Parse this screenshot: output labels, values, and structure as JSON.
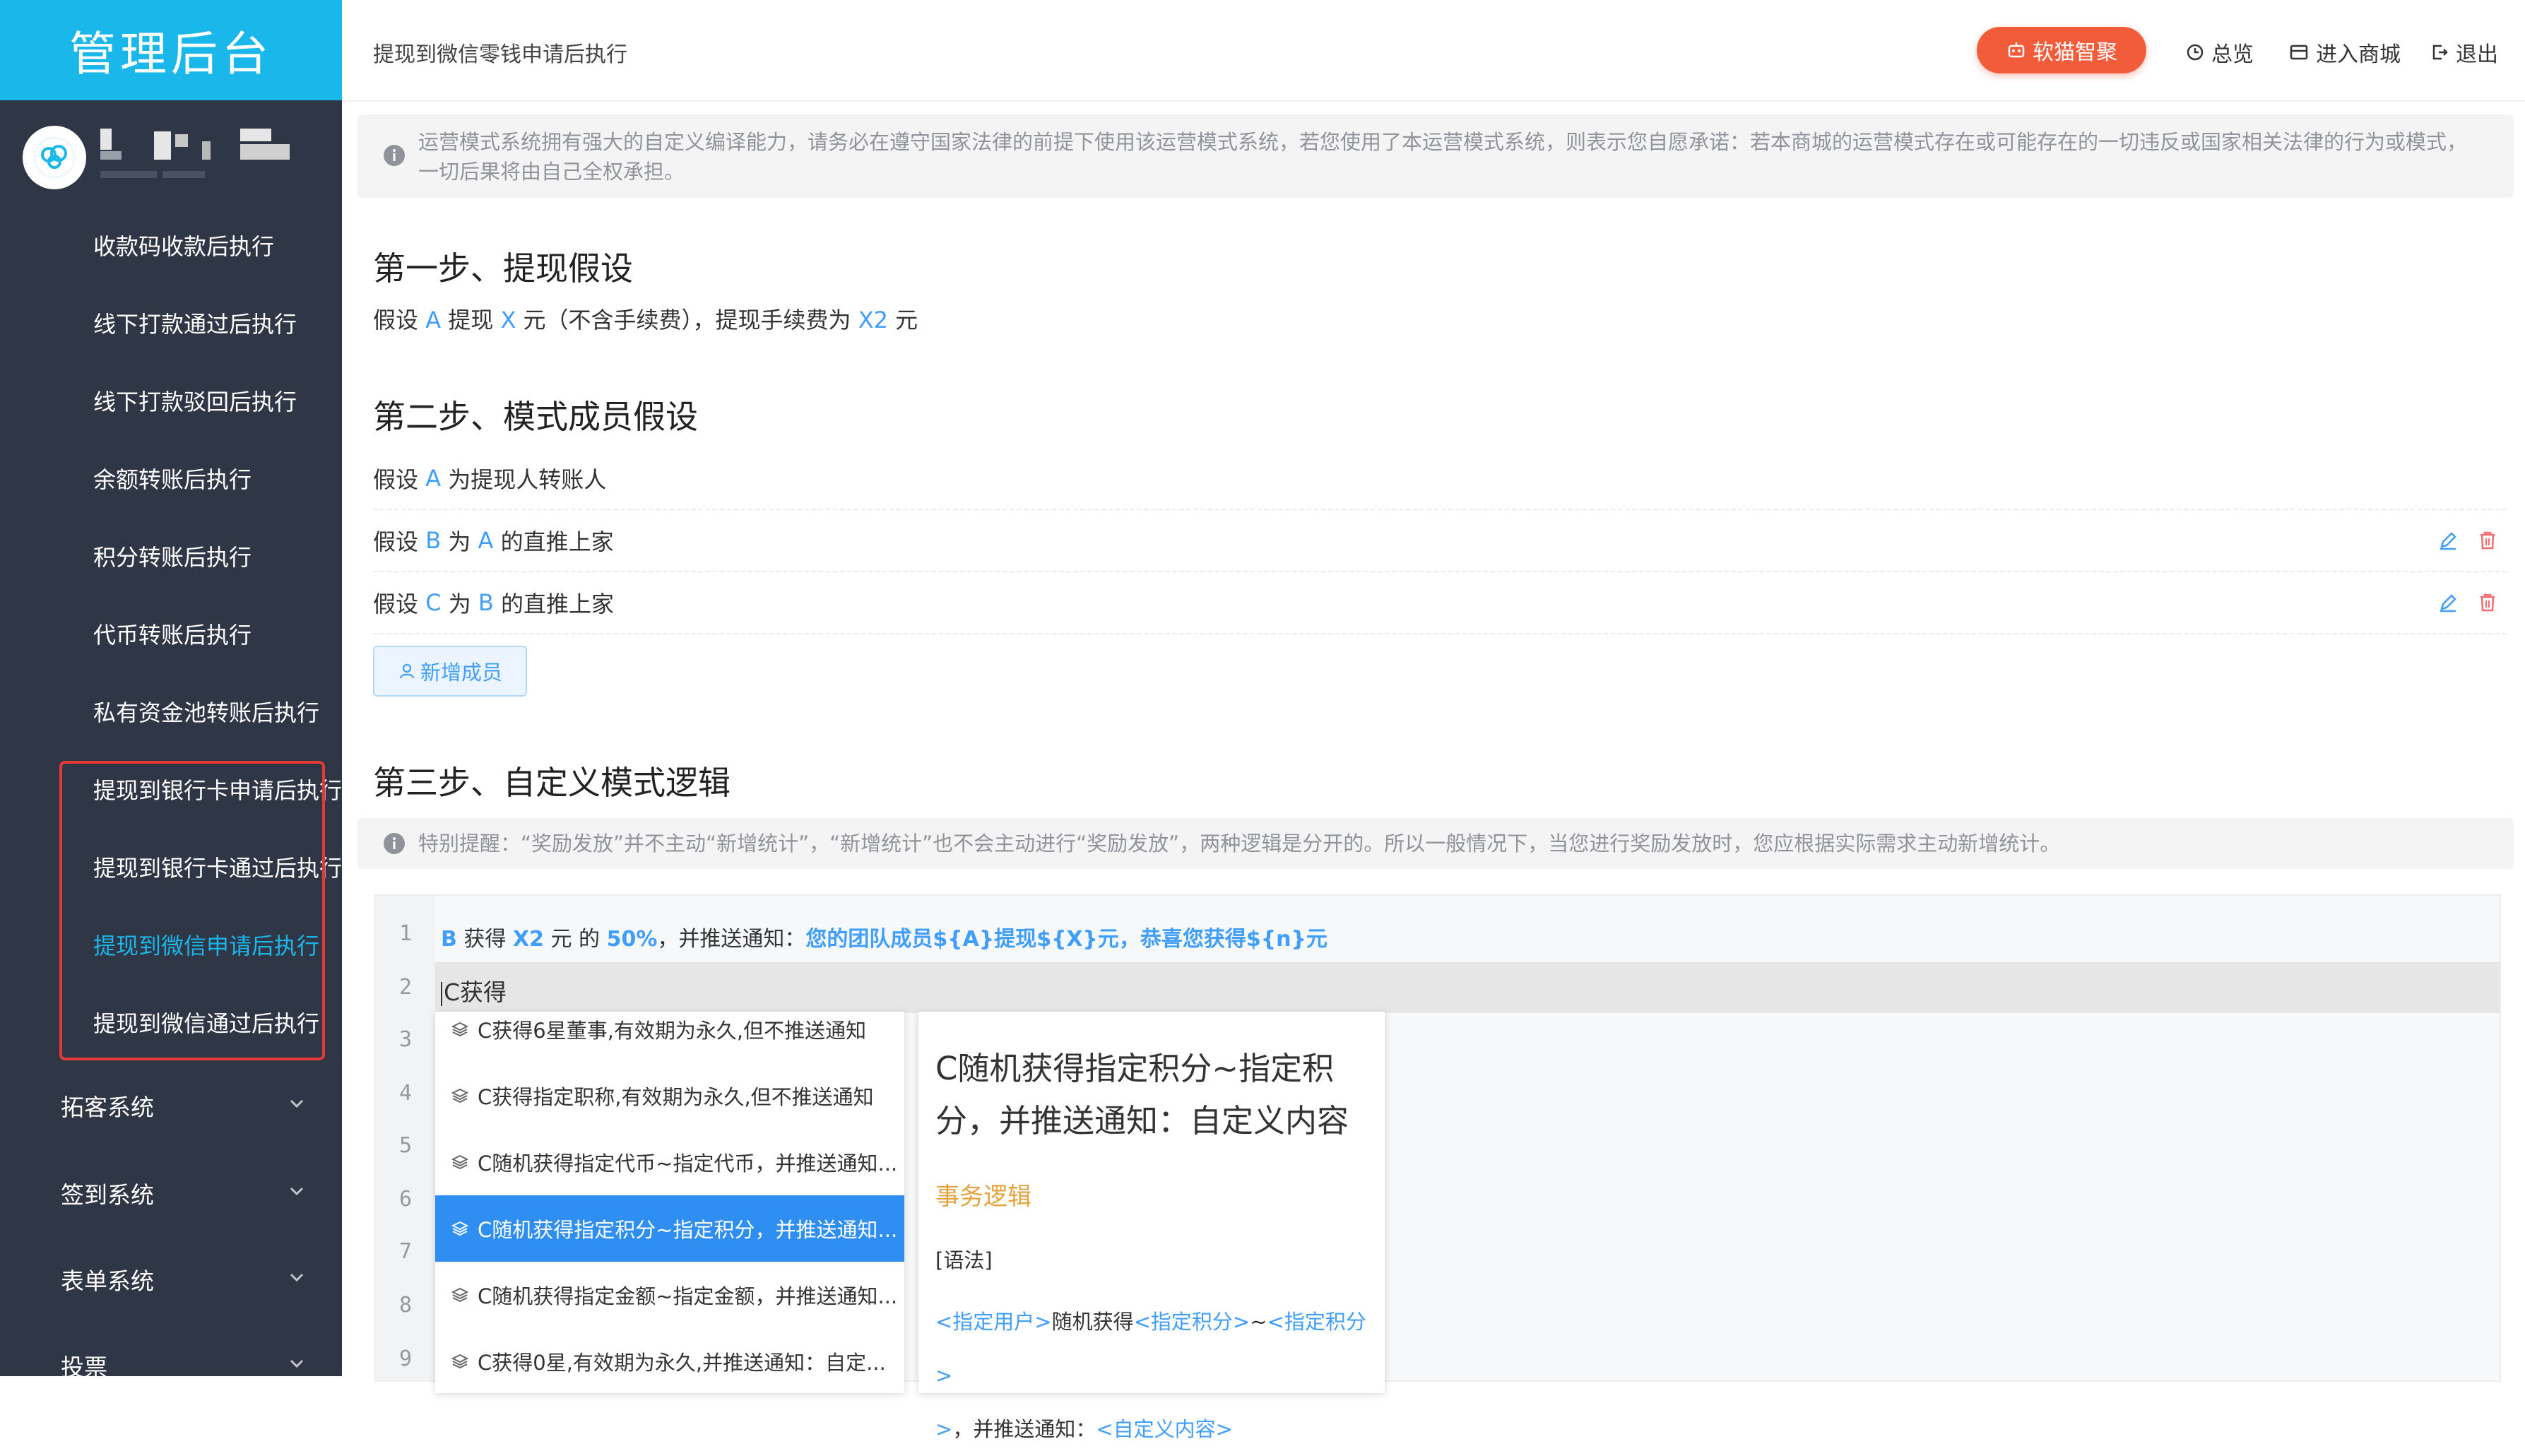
{
  "sidebar": {
    "brand": "管理后台",
    "items": [
      {
        "label": "收款码收款后执行"
      },
      {
        "label": "线下打款通过后执行"
      },
      {
        "label": "线下打款驳回后执行"
      },
      {
        "label": "余额转账后执行"
      },
      {
        "label": "积分转账后执行"
      },
      {
        "label": "代币转账后执行"
      },
      {
        "label": "私有资金池转账后执行"
      },
      {
        "label": "提现到银行卡申请后执行"
      },
      {
        "label": "提现到银行卡通过后执行"
      },
      {
        "label": "提现到微信申请后执行"
      },
      {
        "label": "提现到微信通过后执行"
      }
    ],
    "groups": [
      {
        "label": "拓客系统"
      },
      {
        "label": "签到系统"
      },
      {
        "label": "表单系统"
      },
      {
        "label": "投票"
      }
    ],
    "active_color": "#1ab7ea"
  },
  "header": {
    "breadcrumb": "提现到微信零钱申请后执行",
    "ai_button": "软猫智聚",
    "links": {
      "overview": "总览",
      "mall": "进入商城",
      "logout": "退出"
    }
  },
  "notice": "运营模式系统拥有强大的自定义编译能力，请务必在遵守国家法律的前提下使用该运营模式系统，若您使用了本运营模式系统，则表示您自愿承诺：若本商城的运营模式存在或可能存在的一切违反或国家相关法律的行为或模式，一切后果将由自己全权承担。",
  "step1": {
    "title": "第一步、提现假设",
    "t1": "假设",
    "a": "A",
    "t2": "提现",
    "x": "X",
    "t3": "元（不含手续费），提现手续费为",
    "x2": "X2",
    "t4": "元"
  },
  "step2": {
    "title": "第二步、模式成员假设",
    "rows": [
      {
        "t1": "假设",
        "v1": "A",
        "t2": "为提现人转账人"
      },
      {
        "t1": "假设",
        "v1": "B",
        "t2": "为",
        "v2": "A",
        "t3": "的直推上家"
      },
      {
        "t1": "假设",
        "v1": "C",
        "t2": "为",
        "v2": "B",
        "t3": "的直推上家"
      }
    ],
    "add_button": "新增成员"
  },
  "step3": {
    "title": "第三步、自定义模式逻辑",
    "notice": "特别提醒：“奖励发放”并不主动“新增统计”，“新增统计”也不会主动进行“奖励发放”，两种逻辑是分开的。所以一般情况下，当您进行奖励发放时，您应根据实际需求主动新增统计。"
  },
  "editor": {
    "line_numbers": [
      "1",
      "2",
      "3",
      "4",
      "5",
      "6",
      "7",
      "8",
      "9"
    ],
    "line1": {
      "b": "B",
      "t1": " 获得 ",
      "x2": "X2",
      "t2": " 元 的 ",
      "pct": "50%",
      "t3": "，并推送通知：",
      "msg": "您的团队成员${A}提现${X}元，恭喜您获得${n}元"
    },
    "line2": "C获得",
    "suggestions": [
      "C获得6星董事,有效期为永久,但不推送通知",
      "C获得指定职称,有效期为永久,但不推送通知",
      "C随机获得指定代币~指定代币，并推送通知...",
      "C随机获得指定积分~指定积分，并推送通知...",
      "C随机获得指定金额~指定金额，并推送通知...",
      "C获得0星,有效期为永久,并推送通知：自定..."
    ],
    "selected_index": 3,
    "doc": {
      "title": "C随机获得指定积分~指定积分，并推送通知：自定义内容",
      "category": "事务逻辑",
      "syntax_label": "[语法]",
      "s1": "<指定用户>",
      "s2": "随机获得",
      "s3": "<指定积分>",
      "s4": "~",
      "s5": "<指定积分>",
      "s6": ">",
      "s7": "，并推送通知：",
      "s8": "<自定义内容>"
    }
  },
  "colors": {
    "link_blue": "#409eff",
    "orange": "#e6a23c",
    "ai_btn": "#f35c3b"
  }
}
